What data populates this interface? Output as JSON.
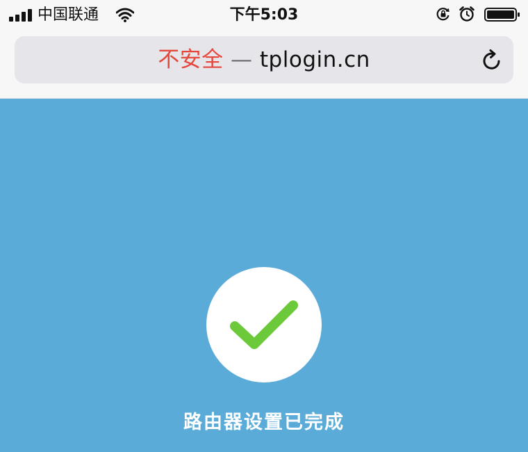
{
  "status_bar": {
    "carrier": "中国联通",
    "time": "下午5:03"
  },
  "address_bar": {
    "insecure_label": "不安全",
    "separator": "—",
    "domain": "tplogin.cn"
  },
  "main": {
    "status_message": "路由器设置已完成"
  },
  "colors": {
    "page_background": "#5babd9",
    "insecure_red": "#e5473d",
    "check_green": "#6cc93a"
  }
}
